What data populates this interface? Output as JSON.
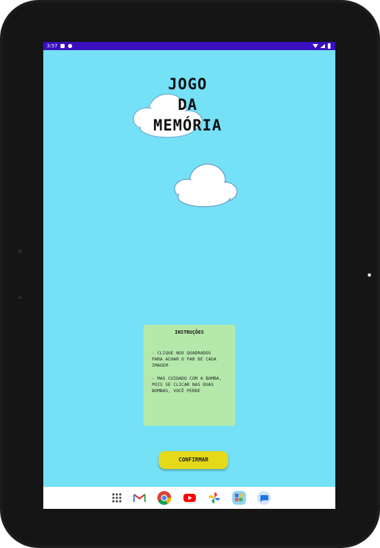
{
  "statusbar": {
    "time": "3:57"
  },
  "game": {
    "title_line1": "JOGO",
    "title_line2": "DA",
    "title_line3": "MEMÓRIA"
  },
  "instructions": {
    "title": "INSTRUÇÕES",
    "text1": "- CLIQUE NOS QUADRADOS PARA ACHAR O PAR DE CADA IMAGEM",
    "text2": "- MAS CUIDADO COM A BOMBA, POIS SE CLICAR NAS DUAS BOMBAS, VOCÊ PERDE"
  },
  "confirm_label": "CONFIRMAR",
  "colors": {
    "background": "#74e1f7",
    "statusbar": "#3a0fbf",
    "panel": "#b5e9ac",
    "button": "#e4da1a"
  },
  "dock": {
    "apps": [
      "app-drawer-icon",
      "gmail-icon",
      "chrome-icon",
      "youtube-icon",
      "photos-icon",
      "kids-app-icon",
      "messages-icon"
    ]
  }
}
